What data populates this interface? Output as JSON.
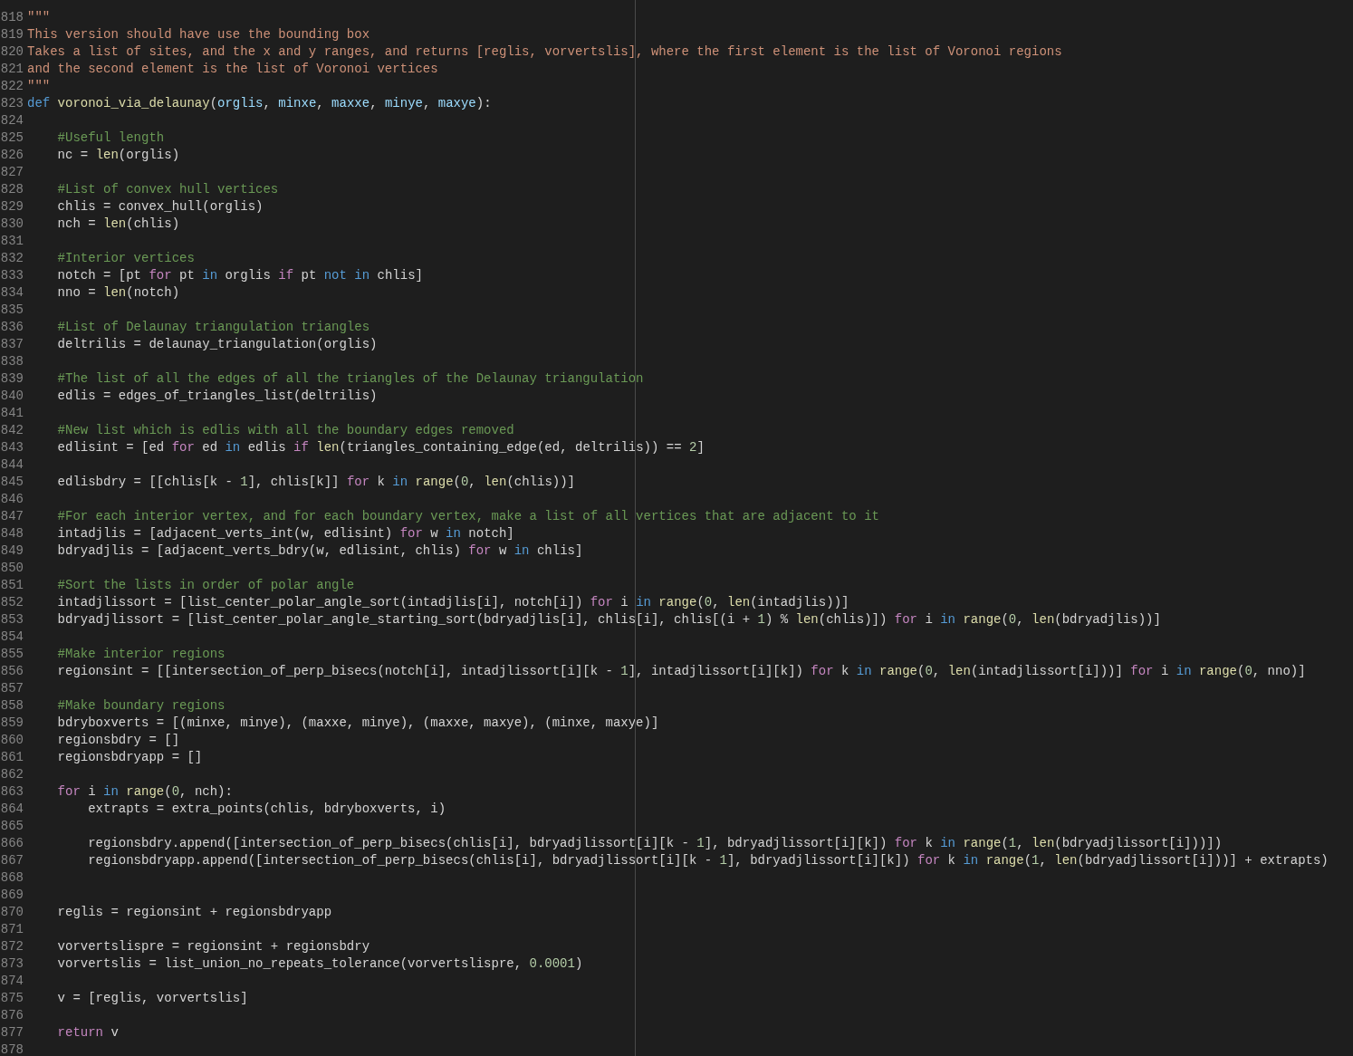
{
  "editor": {
    "lines": [
      {
        "number": "818",
        "tokens": [
          {
            "kind": "string",
            "text": "\"\"\""
          }
        ]
      },
      {
        "number": "819",
        "tokens": [
          {
            "kind": "string",
            "text": "This version should have use the bounding box"
          }
        ]
      },
      {
        "number": "820",
        "tokens": [
          {
            "kind": "string",
            "text": "Takes a list of sites, and the x and y ranges, and returns [reglis, vorvertslis], where the first element is the list of Voronoi regions"
          }
        ]
      },
      {
        "number": "821",
        "tokens": [
          {
            "kind": "string",
            "text": "and the second element is the list of Voronoi vertices"
          }
        ]
      },
      {
        "number": "822",
        "tokens": [
          {
            "kind": "string",
            "text": "\"\"\""
          }
        ]
      },
      {
        "number": "823",
        "tokens": [
          {
            "kind": "keyword",
            "text": "def "
          },
          {
            "kind": "function",
            "text": "voronoi_via_delaunay"
          },
          {
            "kind": "plain",
            "text": "("
          },
          {
            "kind": "param",
            "text": "orglis"
          },
          {
            "kind": "plain",
            "text": ", "
          },
          {
            "kind": "param",
            "text": "minxe"
          },
          {
            "kind": "plain",
            "text": ", "
          },
          {
            "kind": "param",
            "text": "maxxe"
          },
          {
            "kind": "plain",
            "text": ", "
          },
          {
            "kind": "param",
            "text": "minye"
          },
          {
            "kind": "plain",
            "text": ", "
          },
          {
            "kind": "param",
            "text": "maxye"
          },
          {
            "kind": "plain",
            "text": "):"
          }
        ]
      },
      {
        "number": "824"
      },
      {
        "number": "825",
        "tokens": [
          {
            "kind": "comment",
            "text": "    #Useful length"
          }
        ]
      },
      {
        "number": "826",
        "tokens": [
          {
            "kind": "plain",
            "text": "    nc = "
          },
          {
            "kind": "function",
            "text": "len"
          },
          {
            "kind": "plain",
            "text": "(orglis)"
          }
        ]
      },
      {
        "number": "827"
      },
      {
        "number": "828",
        "tokens": [
          {
            "kind": "comment",
            "text": "    #List of convex hull vertices"
          }
        ]
      },
      {
        "number": "829",
        "tokens": [
          {
            "kind": "plain",
            "text": "    chlis = convex_hull(orglis)"
          }
        ]
      },
      {
        "number": "830",
        "tokens": [
          {
            "kind": "plain",
            "text": "    nch = "
          },
          {
            "kind": "function",
            "text": "len"
          },
          {
            "kind": "plain",
            "text": "(chlis)"
          }
        ]
      },
      {
        "number": "831"
      },
      {
        "number": "832",
        "tokens": [
          {
            "kind": "comment",
            "text": "    #Interior vertices"
          }
        ]
      },
      {
        "number": "833",
        "tokens": [
          {
            "kind": "plain",
            "text": "    notch = [pt "
          },
          {
            "kind": "control",
            "text": "for"
          },
          {
            "kind": "plain",
            "text": " pt "
          },
          {
            "kind": "keyword",
            "text": "in"
          },
          {
            "kind": "plain",
            "text": " orglis "
          },
          {
            "kind": "control",
            "text": "if"
          },
          {
            "kind": "plain",
            "text": " pt "
          },
          {
            "kind": "keyword",
            "text": "not in"
          },
          {
            "kind": "plain",
            "text": " chlis]"
          }
        ]
      },
      {
        "number": "834",
        "tokens": [
          {
            "kind": "plain",
            "text": "    nno = "
          },
          {
            "kind": "function",
            "text": "len"
          },
          {
            "kind": "plain",
            "text": "(notch)"
          }
        ]
      },
      {
        "number": "835"
      },
      {
        "number": "836",
        "tokens": [
          {
            "kind": "comment",
            "text": "    #List of Delaunay triangulation triangles"
          }
        ]
      },
      {
        "number": "837",
        "tokens": [
          {
            "kind": "plain",
            "text": "    deltrilis = delaunay_triangulation(orglis)"
          }
        ]
      },
      {
        "number": "838"
      },
      {
        "number": "839",
        "tokens": [
          {
            "kind": "comment",
            "text": "    #The list of all the edges of all the triangles of the Delaunay triangulation"
          }
        ]
      },
      {
        "number": "840",
        "tokens": [
          {
            "kind": "plain",
            "text": "    edlis = edges_of_triangles_list(deltrilis)"
          }
        ]
      },
      {
        "number": "841"
      },
      {
        "number": "842",
        "tokens": [
          {
            "kind": "comment",
            "text": "    #New list which is edlis with all the boundary edges removed"
          }
        ]
      },
      {
        "number": "843",
        "tokens": [
          {
            "kind": "plain",
            "text": "    edlisint = [ed "
          },
          {
            "kind": "control",
            "text": "for"
          },
          {
            "kind": "plain",
            "text": " ed "
          },
          {
            "kind": "keyword",
            "text": "in"
          },
          {
            "kind": "plain",
            "text": " edlis "
          },
          {
            "kind": "control",
            "text": "if "
          },
          {
            "kind": "function",
            "text": "len"
          },
          {
            "kind": "plain",
            "text": "(triangles_containing_edge(ed, deltrilis)) == "
          },
          {
            "kind": "number",
            "text": "2"
          },
          {
            "kind": "plain",
            "text": "]"
          }
        ]
      },
      {
        "number": "844"
      },
      {
        "number": "845",
        "tokens": [
          {
            "kind": "plain",
            "text": "    edlisbdry = [[chlis[k - "
          },
          {
            "kind": "number",
            "text": "1"
          },
          {
            "kind": "plain",
            "text": "], chlis[k]] "
          },
          {
            "kind": "control",
            "text": "for"
          },
          {
            "kind": "plain",
            "text": " k "
          },
          {
            "kind": "keyword",
            "text": "in "
          },
          {
            "kind": "function",
            "text": "range"
          },
          {
            "kind": "plain",
            "text": "("
          },
          {
            "kind": "number",
            "text": "0"
          },
          {
            "kind": "plain",
            "text": ", "
          },
          {
            "kind": "function",
            "text": "len"
          },
          {
            "kind": "plain",
            "text": "(chlis))]"
          }
        ]
      },
      {
        "number": "846"
      },
      {
        "number": "847",
        "tokens": [
          {
            "kind": "comment",
            "text": "    #For each interior vertex, and for each boundary vertex, make a list of all vertices that are adjacent to it"
          }
        ]
      },
      {
        "number": "848",
        "tokens": [
          {
            "kind": "plain",
            "text": "    intadjlis = [adjacent_verts_int(w, edlisint) "
          },
          {
            "kind": "control",
            "text": "for"
          },
          {
            "kind": "plain",
            "text": " w "
          },
          {
            "kind": "keyword",
            "text": "in"
          },
          {
            "kind": "plain",
            "text": " notch]"
          }
        ]
      },
      {
        "number": "849",
        "tokens": [
          {
            "kind": "plain",
            "text": "    bdryadjlis = [adjacent_verts_bdry(w, edlisint, chlis) "
          },
          {
            "kind": "control",
            "text": "for"
          },
          {
            "kind": "plain",
            "text": " w "
          },
          {
            "kind": "keyword",
            "text": "in"
          },
          {
            "kind": "plain",
            "text": " chlis]"
          }
        ]
      },
      {
        "number": "850"
      },
      {
        "number": "851",
        "tokens": [
          {
            "kind": "comment",
            "text": "    #Sort the lists in order of polar angle"
          }
        ]
      },
      {
        "number": "852",
        "tokens": [
          {
            "kind": "plain",
            "text": "    intadjlissort = [list_center_polar_angle_sort(intadjlis[i], notch[i]) "
          },
          {
            "kind": "control",
            "text": "for"
          },
          {
            "kind": "plain",
            "text": " i "
          },
          {
            "kind": "keyword",
            "text": "in "
          },
          {
            "kind": "function",
            "text": "range"
          },
          {
            "kind": "plain",
            "text": "("
          },
          {
            "kind": "number",
            "text": "0"
          },
          {
            "kind": "plain",
            "text": ", "
          },
          {
            "kind": "function",
            "text": "len"
          },
          {
            "kind": "plain",
            "text": "(intadjlis))]"
          }
        ]
      },
      {
        "number": "853",
        "tokens": [
          {
            "kind": "plain",
            "text": "    bdryadjlissort = [list_center_polar_angle_starting_sort(bdryadjlis[i], chlis[i], chlis[(i + "
          },
          {
            "kind": "number",
            "text": "1"
          },
          {
            "kind": "plain",
            "text": ") % "
          },
          {
            "kind": "function",
            "text": "len"
          },
          {
            "kind": "plain",
            "text": "(chlis)]) "
          },
          {
            "kind": "control",
            "text": "for"
          },
          {
            "kind": "plain",
            "text": " i "
          },
          {
            "kind": "keyword",
            "text": "in "
          },
          {
            "kind": "function",
            "text": "range"
          },
          {
            "kind": "plain",
            "text": "("
          },
          {
            "kind": "number",
            "text": "0"
          },
          {
            "kind": "plain",
            "text": ", "
          },
          {
            "kind": "function",
            "text": "len"
          },
          {
            "kind": "plain",
            "text": "(bdryadjlis))]"
          }
        ]
      },
      {
        "number": "854"
      },
      {
        "number": "855",
        "tokens": [
          {
            "kind": "comment",
            "text": "    #Make interior regions"
          }
        ]
      },
      {
        "number": "856",
        "tokens": [
          {
            "kind": "plain",
            "text": "    regionsint = [[intersection_of_perp_bisecs(notch[i], intadjlissort[i][k - "
          },
          {
            "kind": "number",
            "text": "1"
          },
          {
            "kind": "plain",
            "text": "], intadjlissort[i][k]) "
          },
          {
            "kind": "control",
            "text": "for"
          },
          {
            "kind": "plain",
            "text": " k "
          },
          {
            "kind": "keyword",
            "text": "in "
          },
          {
            "kind": "function",
            "text": "range"
          },
          {
            "kind": "plain",
            "text": "("
          },
          {
            "kind": "number",
            "text": "0"
          },
          {
            "kind": "plain",
            "text": ", "
          },
          {
            "kind": "function",
            "text": "len"
          },
          {
            "kind": "plain",
            "text": "(intadjlissort[i]))] "
          },
          {
            "kind": "control",
            "text": "for"
          },
          {
            "kind": "plain",
            "text": " i "
          },
          {
            "kind": "keyword",
            "text": "in "
          },
          {
            "kind": "function",
            "text": "range"
          },
          {
            "kind": "plain",
            "text": "("
          },
          {
            "kind": "number",
            "text": "0"
          },
          {
            "kind": "plain",
            "text": ", nno)]"
          }
        ]
      },
      {
        "number": "857"
      },
      {
        "number": "858",
        "tokens": [
          {
            "kind": "comment",
            "text": "    #Make boundary regions"
          }
        ]
      },
      {
        "number": "859",
        "tokens": [
          {
            "kind": "plain",
            "text": "    bdryboxverts = [(minxe, minye), (maxxe, minye), (maxxe, maxye), (minxe, maxye)]"
          }
        ]
      },
      {
        "number": "860",
        "tokens": [
          {
            "kind": "plain",
            "text": "    regionsbdry = []"
          }
        ]
      },
      {
        "number": "861",
        "tokens": [
          {
            "kind": "plain",
            "text": "    regionsbdryapp = []"
          }
        ]
      },
      {
        "number": "862"
      },
      {
        "number": "863",
        "tokens": [
          {
            "kind": "control",
            "text": "    for"
          },
          {
            "kind": "plain",
            "text": " i "
          },
          {
            "kind": "keyword",
            "text": "in "
          },
          {
            "kind": "function",
            "text": "range"
          },
          {
            "kind": "plain",
            "text": "("
          },
          {
            "kind": "number",
            "text": "0"
          },
          {
            "kind": "plain",
            "text": ", nch):"
          }
        ]
      },
      {
        "number": "864",
        "tokens": [
          {
            "kind": "plain",
            "text": "        extrapts = extra_points(chlis, bdryboxverts, i)"
          }
        ]
      },
      {
        "number": "865"
      },
      {
        "number": "866",
        "tokens": [
          {
            "kind": "plain",
            "text": "        regionsbdry.append([intersection_of_perp_bisecs(chlis[i], bdryadjlissort[i][k - "
          },
          {
            "kind": "number",
            "text": "1"
          },
          {
            "kind": "plain",
            "text": "], bdryadjlissort[i][k]) "
          },
          {
            "kind": "control",
            "text": "for"
          },
          {
            "kind": "plain",
            "text": " k "
          },
          {
            "kind": "keyword",
            "text": "in "
          },
          {
            "kind": "function",
            "text": "range"
          },
          {
            "kind": "plain",
            "text": "("
          },
          {
            "kind": "number",
            "text": "1"
          },
          {
            "kind": "plain",
            "text": ", "
          },
          {
            "kind": "function",
            "text": "len"
          },
          {
            "kind": "plain",
            "text": "(bdryadjlissort[i]))])"
          }
        ]
      },
      {
        "number": "867",
        "tokens": [
          {
            "kind": "plain",
            "text": "        regionsbdryapp.append([intersection_of_perp_bisecs(chlis[i], bdryadjlissort[i][k - "
          },
          {
            "kind": "number",
            "text": "1"
          },
          {
            "kind": "plain",
            "text": "], bdryadjlissort[i][k]) "
          },
          {
            "kind": "control",
            "text": "for"
          },
          {
            "kind": "plain",
            "text": " k "
          },
          {
            "kind": "keyword",
            "text": "in "
          },
          {
            "kind": "function",
            "text": "range"
          },
          {
            "kind": "plain",
            "text": "("
          },
          {
            "kind": "number",
            "text": "1"
          },
          {
            "kind": "plain",
            "text": ", "
          },
          {
            "kind": "function",
            "text": "len"
          },
          {
            "kind": "plain",
            "text": "(bdryadjlissort[i]))] + extrapts)"
          }
        ]
      },
      {
        "number": "868"
      },
      {
        "number": "869"
      },
      {
        "number": "870",
        "tokens": [
          {
            "kind": "plain",
            "text": "    reglis = regionsint + regionsbdryapp"
          }
        ]
      },
      {
        "number": "871"
      },
      {
        "number": "872",
        "tokens": [
          {
            "kind": "plain",
            "text": "    vorvertslispre = regionsint + regionsbdry"
          }
        ]
      },
      {
        "number": "873",
        "tokens": [
          {
            "kind": "plain",
            "text": "    vorvertslis = list_union_no_repeats_tolerance(vorvertslispre, "
          },
          {
            "kind": "number",
            "text": "0.0001"
          },
          {
            "kind": "plain",
            "text": ")"
          }
        ]
      },
      {
        "number": "874"
      },
      {
        "number": "875",
        "tokens": [
          {
            "kind": "plain",
            "text": "    v = [reglis, vorvertslis]"
          }
        ]
      },
      {
        "number": "876"
      },
      {
        "number": "877",
        "tokens": [
          {
            "kind": "control",
            "text": "    return"
          },
          {
            "kind": "plain",
            "text": " v"
          }
        ]
      },
      {
        "number": "878"
      }
    ]
  }
}
